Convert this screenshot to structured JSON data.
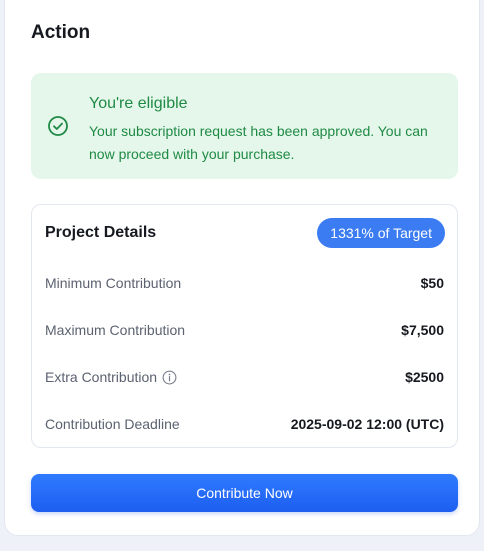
{
  "action": {
    "title": "Action"
  },
  "alert": {
    "title": "You're eligible",
    "message": "Your subscription request has been approved. You can now proceed with your purchase.",
    "icon": "check-circle-icon",
    "color": "#1f8a45",
    "background": "#e4f7ea"
  },
  "details": {
    "title": "Project Details",
    "target_badge": "1331% of Target",
    "rows": [
      {
        "label": "Minimum Contribution",
        "value": "$50"
      },
      {
        "label": "Maximum Contribution",
        "value": "$7,500"
      },
      {
        "label": "Extra Contribution",
        "value": "$2500",
        "icon": "info-circle-icon"
      },
      {
        "label": "Contribution Deadline",
        "value": "2025-09-02 12:00 (UTC)"
      }
    ]
  },
  "cta": {
    "label": "Contribute Now",
    "color": "#2f7bff"
  }
}
